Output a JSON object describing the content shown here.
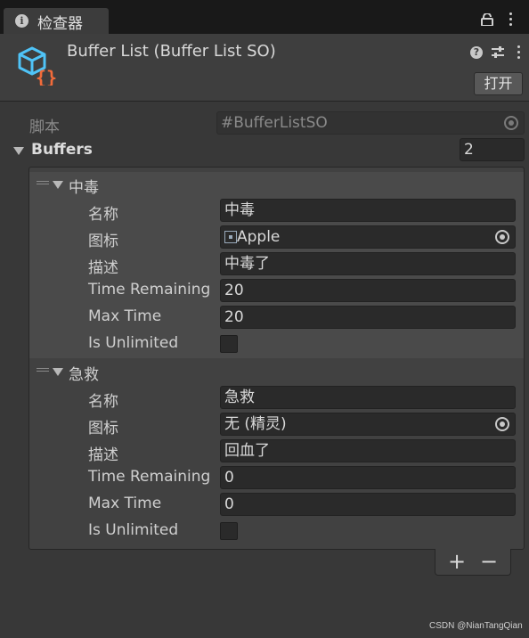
{
  "window": {
    "tab_title": "检查器"
  },
  "header": {
    "object_title": "Buffer List (Buffer List SO)",
    "open_button": "打开"
  },
  "script": {
    "label": "脚本",
    "value": "BufferListSO",
    "value_prefix": "#"
  },
  "buffers": {
    "label": "Buffers",
    "count": "2",
    "elements": [
      {
        "header": "中毒",
        "fields": [
          {
            "label": "名称",
            "value": "中毒"
          },
          {
            "label": "图标",
            "value": "Apple"
          },
          {
            "label": "描述",
            "value": "中毒了"
          },
          {
            "label": "Time Remaining",
            "value": "20"
          },
          {
            "label": "Max Time",
            "value": "20"
          },
          {
            "label": "Is Unlimited",
            "checked": false
          }
        ]
      },
      {
        "header": "急救",
        "fields": [
          {
            "label": "名称",
            "value": "急救"
          },
          {
            "label": "图标",
            "value": "无 (精灵)"
          },
          {
            "label": "描述",
            "value": "回血了"
          },
          {
            "label": "Time Remaining",
            "value": "0"
          },
          {
            "label": "Max Time",
            "value": "0"
          },
          {
            "label": "Is Unlimited",
            "checked": false
          }
        ]
      }
    ],
    "add_label": "+",
    "remove_label": "−"
  },
  "watermark": "CSDN @NianTangQian",
  "colors": {
    "accent_blue": "#4fc3f7",
    "accent_orange": "#f26b3a",
    "background": "#383838"
  }
}
